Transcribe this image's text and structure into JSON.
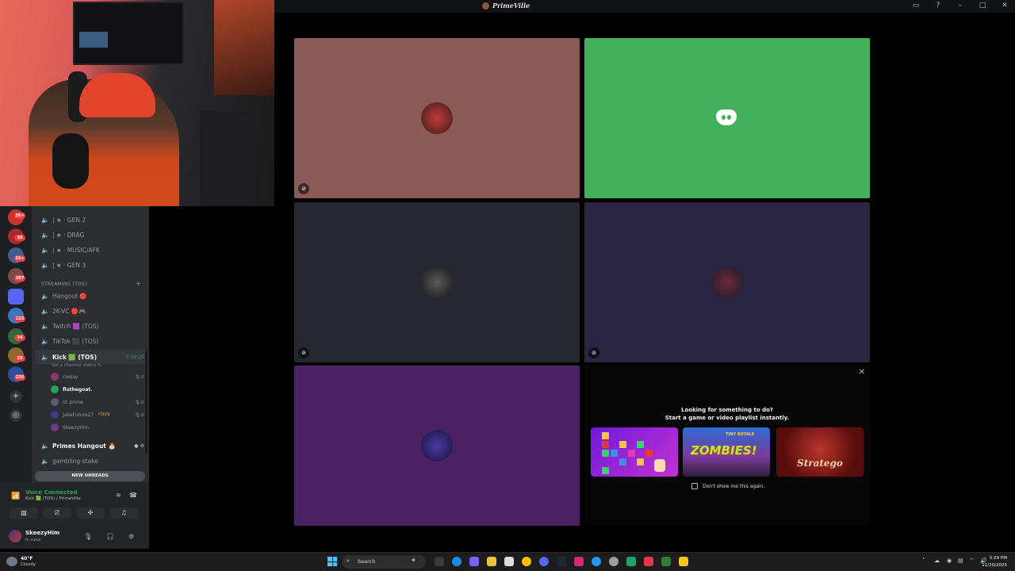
{
  "window": {
    "title": "PrimeVille"
  },
  "channels": {
    "top": [
      {
        "label": "| ★ · GEN 2"
      },
      {
        "label": "| ★ · DRAG"
      },
      {
        "label": "| ★ · MUSIC/AFK"
      },
      {
        "label": "| ★ · GEN 3"
      }
    ],
    "category": "STREAMING (TOS)",
    "category_plus": "+",
    "streaming": [
      {
        "label": "Hangout 🔴"
      },
      {
        "label": "2K-VC 🔴🎮"
      },
      {
        "label": "Twitch 🟪 (TOS)"
      },
      {
        "label": "TikTok ⬛ (TOS)"
      }
    ],
    "active": {
      "label": "Kick 🟩 (TOS)",
      "time": "5:09:25",
      "status_prompt": "Set a channel status ✎"
    },
    "users": [
      {
        "name": "ceejay",
        "bold": false,
        "tag": ""
      },
      {
        "name": "fluthegoat.",
        "bold": true,
        "tag": ""
      },
      {
        "name": "izi prime",
        "bold": false,
        "tag": ""
      },
      {
        "name": "JakeFuture27",
        "bold": false,
        "tag": "⚡DVS"
      },
      {
        "name": "SkeezyHim",
        "bold": false,
        "tag": ""
      }
    ],
    "after": [
      {
        "label": "Primes Hangout 🎂",
        "bold": true
      },
      {
        "label": "gambling-stake",
        "bold": false
      }
    ],
    "new_unreads": "NEW UNREADS"
  },
  "server_badges": [
    "3K+",
    "36",
    "1K+",
    "367",
    "223",
    "34",
    "29",
    "230"
  ],
  "voice": {
    "status": "Voice Connected",
    "location": "Kick 🟩 (TOS) / PrimeVille",
    "me": {
      "name": "SkeezyHim",
      "status": "In voice"
    }
  },
  "activity": {
    "title_line1": "Looking for something to do?",
    "title_line2": "Start a game or video playlist instantly.",
    "zombies_sub": "TINY ROYALE",
    "zombies_title": "ZOMBIES!",
    "stratego_title": "Stratego",
    "dont_show": "Don't show me this again."
  },
  "taskbar": {
    "weather_temp": "40°F",
    "weather_cond": "Cloudy",
    "search_placeholder": "Search",
    "time": "5:29 PM",
    "date": "11/20/2025"
  },
  "colors": {
    "tile1": "#8a5a57",
    "tile2": "#43b15b",
    "tile3": "#26272e",
    "tile4": "#2a2540",
    "tile5": "#4a2263"
  }
}
